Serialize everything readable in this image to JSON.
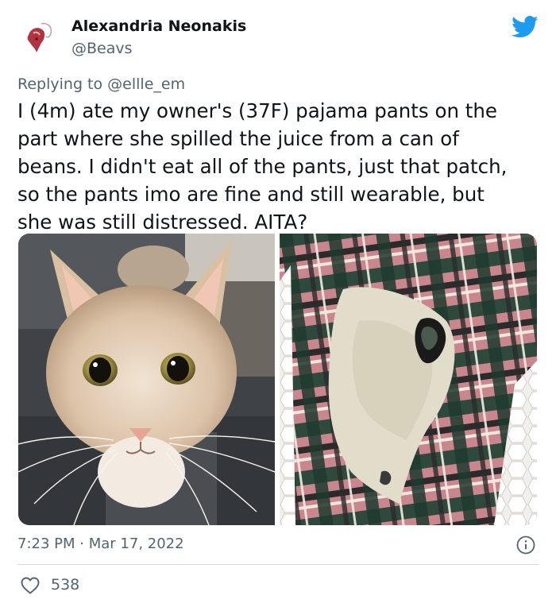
{
  "author": {
    "display_name": "Alexandria Neonakis",
    "handle": "@Beavs"
  },
  "reply": {
    "prefix": "Replying to",
    "mention": "@ellle_em"
  },
  "tweet_text_lines": [
    "I (4m) ate my owner's (37F) pajama pants on the",
    "part where she spilled the juice from a can of",
    "beans. I didn't eat all of the pants, just that patch,",
    "so the pants imo are fine and still wearable, but",
    "she was still distressed. AITA?"
  ],
  "meta": {
    "time": "7:23 PM",
    "separator": "·",
    "date": "Mar 17, 2022"
  },
  "engagement": {
    "likes": "538"
  },
  "icons": {
    "brand": "twitter-bird-icon",
    "info": "info-icon",
    "like": "heart-icon"
  },
  "colors": {
    "twitter_blue": "#1d9bf0",
    "text_primary": "#0f1419",
    "text_secondary": "#536471",
    "divider": "#cfd9de"
  }
}
